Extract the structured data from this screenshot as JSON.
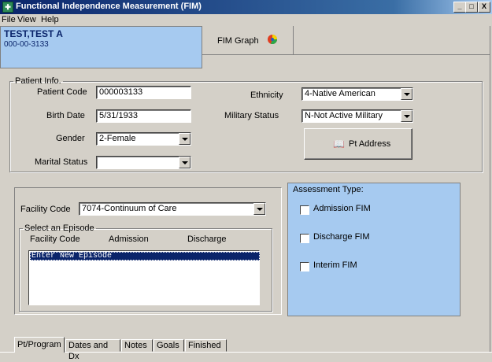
{
  "window": {
    "title": "Functional Independence Measurement (FIM)",
    "controls": {
      "minimize": "_",
      "maximize": "□",
      "close": "X"
    }
  },
  "menu": [
    {
      "label": "File"
    },
    {
      "label": "View"
    },
    {
      "label": "Help"
    }
  ],
  "patient": {
    "name": "TEST,TEST A",
    "id": "000-00-3133"
  },
  "graph_button": {
    "label": "FIM Graph"
  },
  "patient_info": {
    "legend": "Patient Info.",
    "patient_code_label": "Patient Code",
    "patient_code": "000003133",
    "birth_date_label": "Birth Date",
    "birth_date": "5/31/1933",
    "gender_label": "Gender",
    "gender": "2-Female",
    "marital_status_label": "Marital Status",
    "marital_status": "",
    "ethnicity_label": "Ethnicity",
    "ethnicity": "4-Native American",
    "military_status_label": "Military Status",
    "military_status": "N-Not Active Military",
    "address_button": "Pt Address"
  },
  "facility": {
    "label": "Facility Code",
    "value": "7074-Continuum of Care"
  },
  "episode": {
    "legend": "Select an Episode",
    "columns": [
      "Facility Code",
      "Admission",
      "Discharge"
    ],
    "items": [
      "Enter New Episode"
    ]
  },
  "assessment": {
    "title": "Assessment Type:",
    "options": [
      {
        "label": "Admission FIM",
        "checked": false
      },
      {
        "label": "Discharge FIM",
        "checked": false
      },
      {
        "label": "Interim FIM",
        "checked": false
      }
    ]
  },
  "tabs": [
    {
      "label": "Pt/Program",
      "active": true
    },
    {
      "label": "Dates and Dx",
      "active": false
    },
    {
      "label": "Notes",
      "active": false
    },
    {
      "label": "Goals",
      "active": false
    },
    {
      "label": "Finished",
      "active": false
    }
  ]
}
